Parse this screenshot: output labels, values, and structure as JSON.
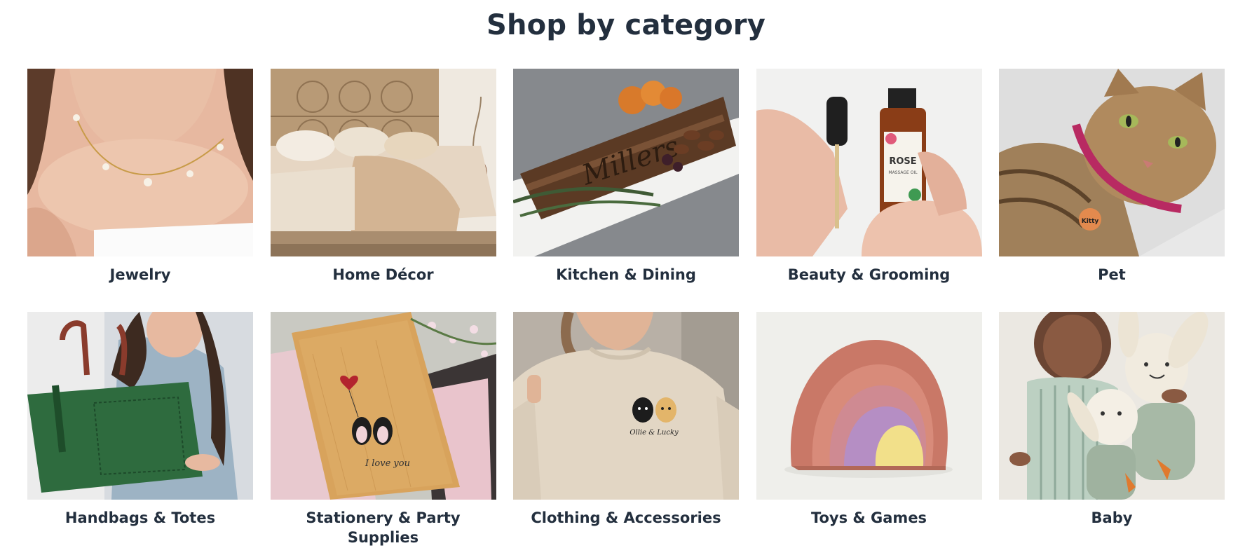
{
  "section": {
    "title": "Shop by category"
  },
  "categories": [
    {
      "label": "Jewelry",
      "image": "woman-wearing-pearl-necklace"
    },
    {
      "label": "Home Décor",
      "image": "bedroom-with-carved-headboard"
    },
    {
      "label": "Kitchen & Dining",
      "image": "engraved-wooden-serving-board"
    },
    {
      "label": "Beauty & Grooming",
      "image": "rose-massage-oil-dropper-bottle"
    },
    {
      "label": "Pet",
      "image": "tabby-cat-with-name-tag"
    },
    {
      "label": "Handbags & Totes",
      "image": "woman-holding-green-leather-tote"
    },
    {
      "label": "Stationery & Party Supplies",
      "image": "wooden-card-with-penguins"
    },
    {
      "label": "Clothing & Accessories",
      "image": "sweatshirt-with-embroidered-dogs"
    },
    {
      "label": "Toys & Games",
      "image": "wooden-rainbow-stacker"
    },
    {
      "label": "Baby",
      "image": "baby-with-bunny-plush-toys"
    }
  ],
  "image_text": {
    "engraved_name": "Millers",
    "oil_bottle_name": "ROSE",
    "oil_bottle_sub": "MASSAGE OIL",
    "pet_tag": "Kitty",
    "card_text": "I love you",
    "embroidery_text": "Ollie & Lucky"
  },
  "colors": {
    "heading": "#232f3e",
    "label": "#232f3e",
    "background": "#ffffff"
  }
}
